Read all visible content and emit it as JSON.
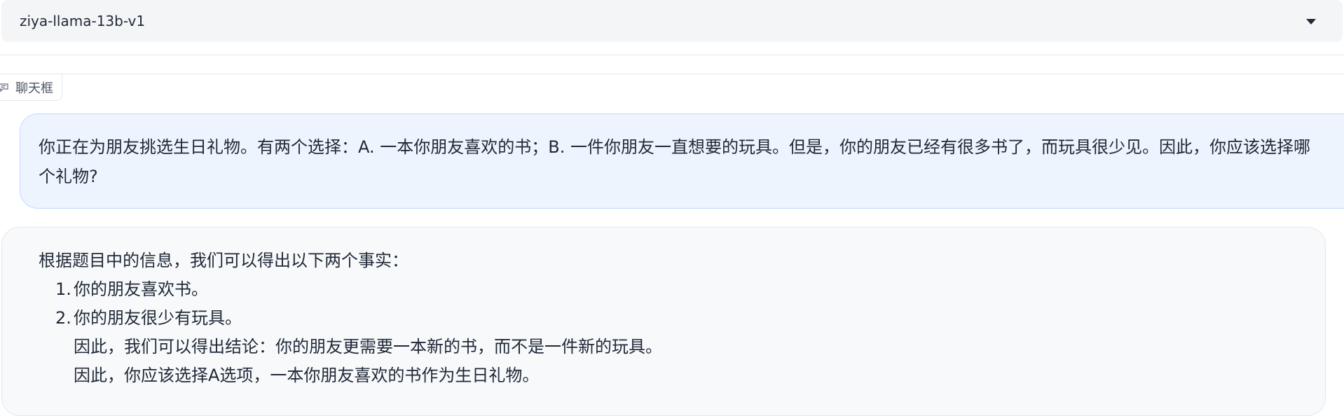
{
  "model_select": {
    "value": "ziya-llama-13b-v1"
  },
  "chat_panel": {
    "label": "聊天框",
    "icon": "chat-icon"
  },
  "messages": {
    "user": {
      "text": "你正在为朋友挑选生日礼物。有两个选择：A. 一本你朋友喜欢的书；B. 一件你朋友一直想要的玩具。但是，你的朋友已经有很多书了，而玩具很少见。因此，你应该选择哪个礼物?"
    },
    "bot": {
      "intro": "根据题目中的信息，我们可以得出以下两个事实：",
      "items": [
        {
          "num": "1.",
          "text": "你的朋友喜欢书。"
        },
        {
          "num": "2.",
          "text": "你的朋友很少有玩具。"
        }
      ],
      "conclusion1": "因此，我们可以得出结论：你的朋友更需要一本新的书，而不是一件新的玩具。",
      "conclusion2": "因此，你应该选择A选项，一本你朋友喜欢的书作为生日礼物。"
    }
  },
  "colors": {
    "user_bubble_bg": "#edf4fd",
    "user_bubble_border": "#bfdbfe",
    "bot_bubble_bg": "#f8f9fb",
    "select_bg": "#f4f5f7"
  }
}
